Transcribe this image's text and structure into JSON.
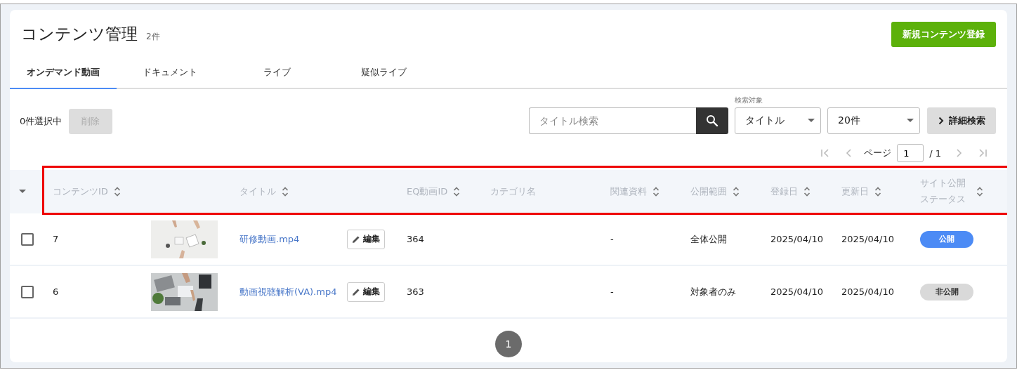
{
  "page": {
    "title": "コンテンツ管理",
    "count": "2件"
  },
  "new_button": {
    "label": "新規コンテンツ登録"
  },
  "tabs": [
    {
      "label": "オンデマンド動画",
      "selected": true
    },
    {
      "label": "ドキュメント",
      "selected": false
    },
    {
      "label": "ライブ",
      "selected": false
    },
    {
      "label": "疑似ライブ",
      "selected": false
    }
  ],
  "selection": {
    "count_label": "0件選択中",
    "delete_button": {
      "label": "削除",
      "disabled": true
    }
  },
  "search": {
    "placeholder": "タイトル検索"
  },
  "search_target": {
    "label": "検索対象",
    "value": "タイトル"
  },
  "page_size": {
    "value": "20件"
  },
  "advanced_search": {
    "label": "詳細検索"
  },
  "pager": {
    "label": "ページ",
    "current": "1",
    "total": "/ 1"
  },
  "columns": [
    {
      "label": "コンテンツID",
      "sortable": true
    },
    {
      "label": "タイトル",
      "sortable": true
    },
    {
      "label": "EQ動画ID",
      "sortable": true
    },
    {
      "label": "カテゴリ名",
      "sortable": false
    },
    {
      "label": "関連資料",
      "sortable": true
    },
    {
      "label": "公開範囲",
      "sortable": true
    },
    {
      "label": "登録日",
      "sortable": true
    },
    {
      "label": "更新日",
      "sortable": true
    },
    {
      "label": "サイト公開ステータス",
      "sortable": true
    }
  ],
  "rows": [
    {
      "checked": false,
      "id": "7",
      "title": "研修動画.mp4",
      "edit": "編集",
      "eq_id": "364",
      "related": "-",
      "scope": "全体公開",
      "registered": "2025/04/10",
      "updated": "2025/04/10",
      "status": {
        "label": "公開",
        "published": true
      }
    },
    {
      "checked": false,
      "id": "6",
      "title": "動画視聴解析(VA).mp4",
      "edit": "編集",
      "eq_id": "363",
      "related": "-",
      "scope": "対象者のみ",
      "registered": "2025/04/10",
      "updated": "2025/04/10",
      "status": {
        "label": "非公開",
        "published": false
      }
    }
  ],
  "pagination": [
    {
      "label": "1",
      "selected": true
    }
  ]
}
